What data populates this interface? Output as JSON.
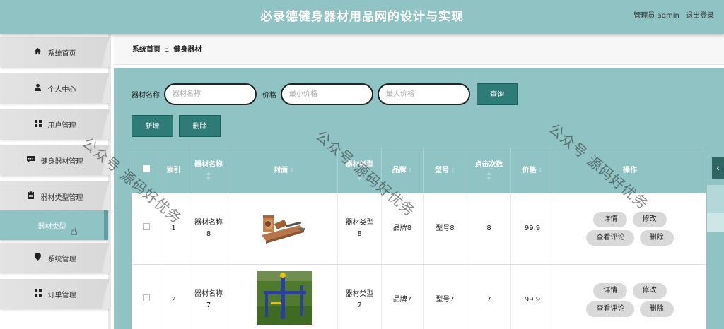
{
  "header": {
    "title": "必录德健身器材用品网的设计与实现",
    "user_label": "管理员 admin",
    "logout_label": "退出登录"
  },
  "sidebar": {
    "items": [
      {
        "label": "系统首页",
        "icon": "home-icon"
      },
      {
        "label": "个人中心",
        "icon": "user-icon"
      },
      {
        "label": "用户管理",
        "icon": "grid-icon"
      },
      {
        "label": "健身器材管理",
        "icon": "comment-icon"
      },
      {
        "label": "器材类型管理",
        "icon": "clipboard-icon"
      },
      {
        "label": "器材类型",
        "icon": "",
        "active": true
      },
      {
        "label": "系统管理",
        "icon": "pin-icon"
      },
      {
        "label": "订单管理",
        "icon": "grid-icon"
      }
    ]
  },
  "breadcrumb": {
    "home": "系统首页",
    "separator": "Ξ",
    "current": "健身器材"
  },
  "search": {
    "name_label": "器材名称",
    "name_placeholder": "器材名称",
    "price_label": "价格",
    "min_placeholder": "最小价格",
    "max_placeholder": "最大价格",
    "query_button": "查询"
  },
  "actions": {
    "add": "新增",
    "delete": "删除"
  },
  "table": {
    "headers": {
      "index": "索引",
      "name": "器材名称",
      "cover": "封面",
      "type": "器材类型",
      "brand": "品牌",
      "model": "型号",
      "clicks": "点击次数",
      "price": "价格",
      "ops": "操作"
    },
    "rows": [
      {
        "index": "1",
        "name": "器材名称8",
        "type": "器材类型8",
        "brand": "品牌8",
        "model": "型号8",
        "clicks": "8",
        "price": "99.9"
      },
      {
        "index": "2",
        "name": "器材名称7",
        "type": "器材类型7",
        "brand": "品牌7",
        "model": "型号7",
        "clicks": "7",
        "price": "99.9"
      }
    ],
    "op_labels": {
      "detail": "详情",
      "edit": "修改",
      "comments": "查看评论",
      "delete": "删除"
    }
  },
  "watermark": "公众号 源码好优务",
  "colors": {
    "header_bg": "#8fc3c4",
    "primary_button": "#2d7c77",
    "active_menu": "#8fc3c4"
  }
}
